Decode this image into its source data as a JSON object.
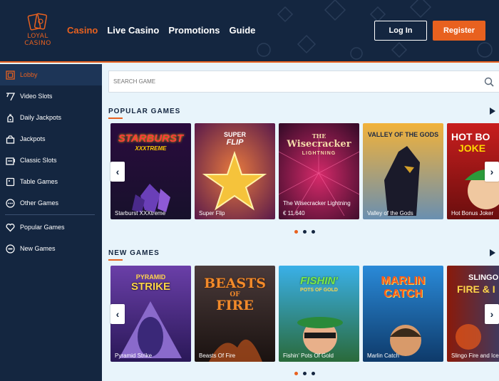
{
  "brand": {
    "line1": "LOYAL",
    "line2": "CASINO",
    "accent": "#e8611f",
    "navy": "#142640"
  },
  "nav": [
    {
      "label": "Casino",
      "active": true
    },
    {
      "label": "Live Casino",
      "active": false
    },
    {
      "label": "Promotions",
      "active": false
    },
    {
      "label": "Guide",
      "active": false
    }
  ],
  "auth": {
    "login": "Log In",
    "register": "Register"
  },
  "sidebar": {
    "items": [
      {
        "label": "Lobby",
        "icon": "lobby-icon"
      },
      {
        "label": "Video Slots",
        "icon": "video-slots-icon"
      },
      {
        "label": "Daily Jackpots",
        "icon": "daily-jackpots-icon"
      },
      {
        "label": "Jackpots",
        "icon": "jackpots-icon"
      },
      {
        "label": "Classic Slots",
        "icon": "classic-slots-icon"
      },
      {
        "label": "Table Games",
        "icon": "table-games-icon"
      },
      {
        "label": "Other Games",
        "icon": "other-games-icon"
      },
      {
        "label": "Popular Games",
        "icon": "heart-icon"
      },
      {
        "label": "New Games",
        "icon": "new-games-icon"
      }
    ]
  },
  "search": {
    "placeholder": "SEARCH GAME"
  },
  "popular": {
    "title": "POPULAR GAMES",
    "games": [
      {
        "name": "Starburst XXXtreme",
        "art1": "STARBURST",
        "art2": "XXXTREME"
      },
      {
        "name": "Super Flip",
        "art1": "SUPER",
        "art2": "FLIP"
      },
      {
        "name": "The Wisecracker Lightning",
        "art1": "THE",
        "art2": "Wisecracker",
        "art3": "LIGHTNING",
        "jackpot": "€ 11.640"
      },
      {
        "name": "Valley of the Gods",
        "art1": "VALLEY OF THE GODS"
      },
      {
        "name": "Hot Bonus Joker",
        "art1": "HOT BO",
        "art2": "JOKE"
      }
    ]
  },
  "newgames": {
    "title": "NEW GAMES",
    "games": [
      {
        "name": "Pyramid Strike",
        "art1": "PYRAMID",
        "art2": "STRIKE"
      },
      {
        "name": "Beasts Of Fire",
        "art1": "BEASTS",
        "art2": "OF",
        "art3": "FIRE"
      },
      {
        "name": "Fishin' Pots Of Gold",
        "art1": "FISHIN'",
        "art2": "POTS OF GOLD"
      },
      {
        "name": "Marlin Catch",
        "art1": "MARLIN",
        "art2": "CATCH"
      },
      {
        "name": "Slingo Fire and Ice",
        "art1": "SLINGO",
        "art2": "FIRE & I"
      }
    ]
  },
  "arrows": {
    "prev": "‹",
    "next": "›"
  }
}
